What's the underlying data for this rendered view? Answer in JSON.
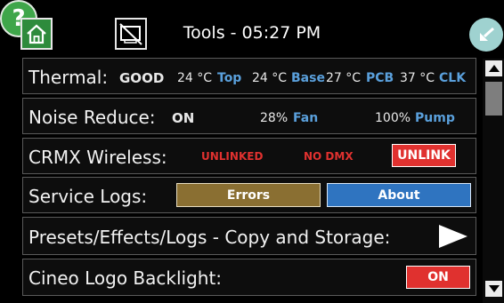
{
  "header": {
    "title": "Tools - 05:27 PM",
    "home_icon": "home-icon",
    "help_symbol": "?",
    "screen_icon": "screen-off-icon",
    "back_icon": "back-arrow-icon"
  },
  "thermal": {
    "label": "Thermal:",
    "status": "GOOD",
    "top_value": "24 °C",
    "top_label": "Top",
    "base_value": "24 °C",
    "base_label": "Base",
    "pcb_value": "27 °C",
    "pcb_label": "PCB",
    "clk_value": "37 °C",
    "clk_label": "CLK"
  },
  "noise": {
    "label": "Noise Reduce:",
    "status": "ON",
    "fan_value": "28%",
    "fan_label": "Fan",
    "pump_value": "100%",
    "pump_label": "Pump"
  },
  "crmx": {
    "label": "CRMX Wireless:",
    "link_status": "UNLINKED",
    "dmx_status": "NO DMX",
    "unlink_button": "UNLINK"
  },
  "service": {
    "label": "Service Logs:",
    "errors_button": "Errors",
    "about_button": "About"
  },
  "presets": {
    "label": "Presets/Effects/Logs - Copy and Storage:"
  },
  "backlight": {
    "label": "Cineo Logo Backlight:",
    "toggle": "ON"
  },
  "colors": {
    "green": "#4ab34a",
    "blue_text": "#5aa0dc",
    "red": "#e0312f",
    "errors_bg": "#8a6f32",
    "about_bg": "#2f74c0"
  }
}
